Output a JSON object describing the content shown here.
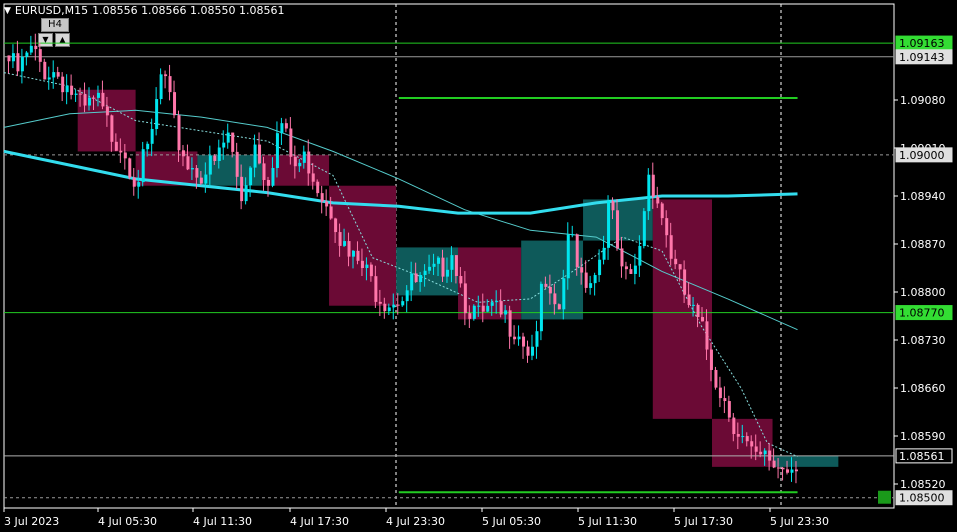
{
  "chart_header": {
    "symbol": "EURUSD",
    "timeframe": "M15",
    "ohlc": "1.08556 1.08566 1.08550 1.08561"
  },
  "mtf_widget": {
    "label": "H4",
    "down_icon": "triangle-down-icon",
    "up_icon": "triangle-up-icon"
  },
  "colors": {
    "background": "#000000",
    "bull_candle": "#00e5ee",
    "bear_candle": "#ff77aa",
    "h4_bear_box": "#6b0a35",
    "h4_bull_box": "#0e5a5a",
    "level_line": "#22cc22",
    "ma_slow": "#33ddee",
    "ma_mid": "#55cccc",
    "ma_fast": "#88dddd",
    "axis_text": "#ffffff",
    "grid": "#ffffff"
  },
  "chart_data": {
    "type": "candlestick",
    "ylim": [
      1.08485,
      1.0922
    ],
    "y_ticks": [
      "1.09080",
      "1.09010",
      "1.08940",
      "1.08870",
      "1.08800",
      "1.08730",
      "1.08660",
      "1.08590",
      "1.08520"
    ],
    "y_tick_values": [
      1.0908,
      1.0901,
      1.0894,
      1.0887,
      1.088,
      1.0873,
      1.0866,
      1.0859,
      1.0852
    ],
    "x_ticks": [
      "3 Jul 2023",
      "4 Jul 05:30",
      "4 Jul 11:30",
      "4 Jul 17:30",
      "4 Jul 23:30",
      "5 Jul 05:30",
      "5 Jul 11:30",
      "5 Jul 17:30",
      "5 Jul 23:30"
    ],
    "horizontal_levels": [
      {
        "label": "1.09163",
        "value": 1.09163,
        "style": "green-badge"
      },
      {
        "label": "1.09143",
        "value": 1.09143,
        "style": "gray-badge"
      },
      {
        "label": "1.09000",
        "value": 1.09,
        "style": "gray-badge"
      },
      {
        "label": "1.08770",
        "value": 1.0877,
        "style": "green-badge"
      },
      {
        "label": "1.08561",
        "value": 1.08561,
        "style": "current-price"
      },
      {
        "label": "1.08500",
        "value": 1.085,
        "style": "gray-badge"
      }
    ],
    "segment_levels": [
      {
        "value": 1.09083,
        "x_from": 0.3,
        "x_to": 0.603
      },
      {
        "value": 1.08508,
        "x_from": 0.3,
        "x_to": 0.603
      }
    ],
    "h4_boxes": [
      {
        "t0": 0.056,
        "t1": 0.1,
        "open": 1.09095,
        "close": 1.09005,
        "dir": "bear"
      },
      {
        "t0": 0.1,
        "t1": 0.147,
        "open": 1.09005,
        "close": 1.08955,
        "dir": "bear"
      },
      {
        "t0": 0.147,
        "t1": 0.196,
        "open": 1.08955,
        "close": 1.09,
        "dir": "bull"
      },
      {
        "t0": 0.196,
        "t1": 0.247,
        "open": 1.09,
        "close": 1.08955,
        "dir": "bear"
      },
      {
        "t0": 0.247,
        "t1": 0.298,
        "open": 1.08955,
        "close": 1.0878,
        "dir": "bear"
      },
      {
        "t0": 0.298,
        "t1": 0.345,
        "open": 1.08795,
        "close": 1.08865,
        "dir": "bull"
      },
      {
        "t0": 0.345,
        "t1": 0.393,
        "open": 1.08865,
        "close": 1.0876,
        "dir": "bear"
      },
      {
        "t0": 0.393,
        "t1": 0.44,
        "open": 1.0876,
        "close": 1.08875,
        "dir": "bull"
      },
      {
        "t0": 0.44,
        "t1": 0.493,
        "open": 1.08875,
        "close": 1.08935,
        "dir": "bull"
      },
      {
        "t0": 0.493,
        "t1": 0.538,
        "open": 1.08935,
        "close": 1.08615,
        "dir": "bear"
      },
      {
        "t0": 0.538,
        "t1": 0.584,
        "open": 1.08615,
        "close": 1.08545,
        "dir": "bear"
      },
      {
        "t0": 0.584,
        "t1": 0.634,
        "open": 1.08545,
        "close": 1.08561,
        "dir": "bull"
      }
    ],
    "m15_path": [
      [
        0.0,
        1.09145
      ],
      [
        0.01,
        1.0912
      ],
      [
        0.02,
        1.0915
      ],
      [
        0.03,
        1.09125
      ],
      [
        0.04,
        1.0912
      ],
      [
        0.05,
        1.09095
      ],
      [
        0.06,
        1.0906
      ],
      [
        0.07,
        1.0908
      ],
      [
        0.08,
        1.09035
      ],
      [
        0.09,
        1.09015
      ],
      [
        0.1,
        1.08965
      ],
      [
        0.11,
        1.09005
      ],
      [
        0.12,
        1.09125
      ],
      [
        0.13,
        1.0903
      ],
      [
        0.14,
        1.08985
      ],
      [
        0.15,
        1.08975
      ],
      [
        0.16,
        1.08985
      ],
      [
        0.17,
        1.0903
      ],
      [
        0.18,
        1.08935
      ],
      [
        0.19,
        1.0902
      ],
      [
        0.2,
        1.08965
      ],
      [
        0.21,
        1.0905
      ],
      [
        0.22,
        1.0898
      ],
      [
        0.23,
        1.08995
      ],
      [
        0.24,
        1.0895
      ],
      [
        0.25,
        1.0892
      ],
      [
        0.26,
        1.0885
      ],
      [
        0.27,
        1.0884
      ],
      [
        0.28,
        1.0881
      ],
      [
        0.29,
        1.0879
      ],
      [
        0.3,
        1.08795
      ],
      [
        0.31,
        1.0881
      ],
      [
        0.32,
        1.08815
      ],
      [
        0.33,
        1.0883
      ],
      [
        0.34,
        1.08865
      ],
      [
        0.35,
        1.0879
      ],
      [
        0.36,
        1.0876
      ],
      [
        0.37,
        1.0877
      ],
      [
        0.38,
        1.0876
      ],
      [
        0.39,
        1.0875
      ],
      [
        0.4,
        1.0871
      ],
      [
        0.41,
        1.0881
      ],
      [
        0.42,
        1.0875
      ],
      [
        0.43,
        1.0889
      ],
      [
        0.44,
        1.0882
      ],
      [
        0.45,
        1.0883
      ],
      [
        0.46,
        1.0893
      ],
      [
        0.47,
        1.0881
      ],
      [
        0.48,
        1.0883
      ],
      [
        0.49,
        1.0898
      ],
      [
        0.5,
        1.0891
      ],
      [
        0.51,
        1.0883
      ],
      [
        0.52,
        1.0878
      ],
      [
        0.53,
        1.0874
      ],
      [
        0.54,
        1.0868
      ],
      [
        0.55,
        1.0863
      ],
      [
        0.56,
        1.0859
      ],
      [
        0.57,
        1.0855
      ],
      [
        0.58,
        1.08555
      ],
      [
        0.59,
        1.08545
      ],
      [
        0.6,
        1.0855
      ],
      [
        0.603,
        1.08561
      ]
    ],
    "ma_slow": [
      [
        0.0,
        1.09005
      ],
      [
        0.05,
        1.08985
      ],
      [
        0.1,
        1.08965
      ],
      [
        0.15,
        1.08955
      ],
      [
        0.2,
        1.08945
      ],
      [
        0.25,
        1.0893
      ],
      [
        0.3,
        1.08925
      ],
      [
        0.345,
        1.08915
      ],
      [
        0.4,
        1.08915
      ],
      [
        0.45,
        1.0893
      ],
      [
        0.5,
        1.0894
      ],
      [
        0.55,
        1.0894
      ],
      [
        0.603,
        1.08943
      ]
    ],
    "ma_mid": [
      [
        0.0,
        1.0904
      ],
      [
        0.05,
        1.0906
      ],
      [
        0.1,
        1.09065
      ],
      [
        0.15,
        1.09055
      ],
      [
        0.2,
        1.0904
      ],
      [
        0.25,
        1.09005
      ],
      [
        0.3,
        1.08965
      ],
      [
        0.35,
        1.0892
      ],
      [
        0.4,
        1.0889
      ],
      [
        0.45,
        1.0888
      ],
      [
        0.5,
        1.0883
      ],
      [
        0.55,
        1.0879
      ],
      [
        0.603,
        1.08745
      ]
    ],
    "ma_fast": [
      [
        0.0,
        1.0912
      ],
      [
        0.05,
        1.091
      ],
      [
        0.1,
        1.0905
      ],
      [
        0.15,
        1.09035
      ],
      [
        0.2,
        1.0902
      ],
      [
        0.25,
        1.0897
      ],
      [
        0.28,
        1.0885
      ],
      [
        0.32,
        1.0882
      ],
      [
        0.36,
        1.08785
      ],
      [
        0.4,
        1.0879
      ],
      [
        0.44,
        1.0884
      ],
      [
        0.47,
        1.0888
      ],
      [
        0.5,
        1.0886
      ],
      [
        0.53,
        1.0875
      ],
      [
        0.56,
        1.0866
      ],
      [
        0.58,
        1.0858
      ],
      [
        0.603,
        1.0856
      ]
    ]
  }
}
